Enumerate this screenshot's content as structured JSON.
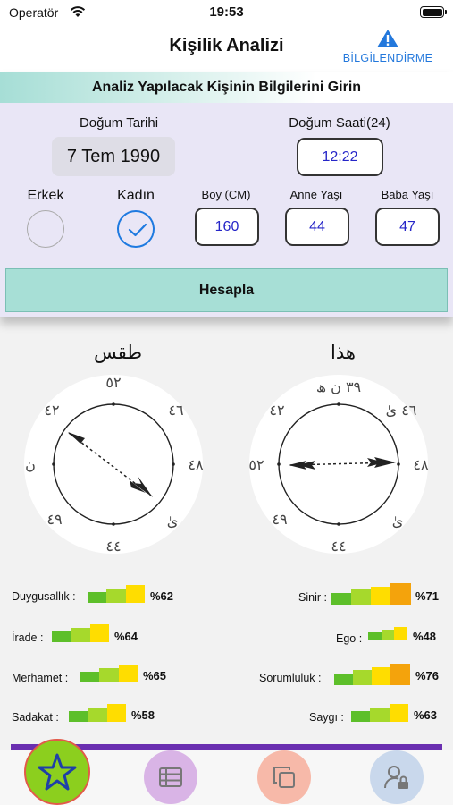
{
  "status": {
    "carrier": "Operatör",
    "time": "19:53"
  },
  "nav": {
    "title": "Kişilik Analizi",
    "info_label": "BİLGİLENDİRME"
  },
  "form": {
    "header": "Analiz Yapılacak Kişinin Bilgilerini Girin",
    "birth_date_label": "Doğum Tarihi",
    "birth_date_value": "7 Tem 1990",
    "birth_time_label": "Doğum Saati(24)",
    "birth_time_value": "12:22",
    "male_label": "Erkek",
    "female_label": "Kadın",
    "gender_selected": "Kadın",
    "height_label": "Boy (CM)",
    "height_value": "160",
    "mother_age_label": "Anne Yaşı",
    "mother_age_value": "44",
    "father_age_label": "Baba Yaşı",
    "father_age_value": "47",
    "calculate_label": "Hesapla"
  },
  "clocks": {
    "left": {
      "title": "طقس",
      "labels": {
        "top": "٥٢",
        "top_left": "٤٢",
        "top_right": "٤٦",
        "left": "ن",
        "right": "٤٨",
        "bottom_left": "٤٩",
        "bottom_right": "ىٰ",
        "bottom": "٤٤"
      }
    },
    "right": {
      "title": "هذا",
      "labels": {
        "top": "٣٩ ن ھ",
        "top_left": "٤٢",
        "top_right": "٤٦ ىٰ",
        "left": "٥٢",
        "right": "٤٨",
        "bottom_left": "٤٩",
        "bottom_right": "ىٰ",
        "bottom": "٤٤"
      }
    }
  },
  "stats": {
    "left": [
      {
        "label": "Duygusallık :",
        "value": "%62",
        "percent": 62
      },
      {
        "label": "İrade :",
        "value": "%64",
        "percent": 64
      },
      {
        "label": "Merhamet :",
        "value": "%65",
        "percent": 65
      },
      {
        "label": "Sadakat :",
        "value": "%58",
        "percent": 58
      }
    ],
    "right": [
      {
        "label": "Sinir :",
        "value": "%71",
        "percent": 71
      },
      {
        "label": "Ego :",
        "value": "%48",
        "percent": 48
      },
      {
        "label": "Sorumluluk :",
        "value": "%76",
        "percent": 76
      },
      {
        "label": "Saygı :",
        "value": "%63",
        "percent": 63
      }
    ]
  },
  "tabs": [
    {
      "icon": "star-icon",
      "color": "#8ccf1e",
      "active": true
    },
    {
      "icon": "list-icon",
      "color": "#d9b4e6"
    },
    {
      "icon": "copy-icon",
      "color": "#f7b9a9"
    },
    {
      "icon": "user-lock-icon",
      "color": "#c9d8ec"
    }
  ],
  "colors": {
    "accent": "#2378dc",
    "panel": "#e9e6f6",
    "button": "#a7dfd6",
    "value_text": "#2626c8"
  }
}
